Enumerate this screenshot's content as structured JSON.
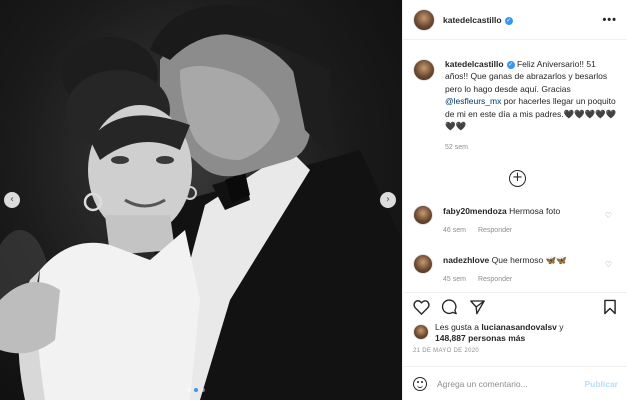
{
  "post": {
    "username": "katedelcastillo",
    "verified_icon": "verified-badge-icon",
    "more_icon": "more-options-icon",
    "carousel": {
      "active_index": 1,
      "count": 3
    }
  },
  "caption": {
    "username": "katedelcastillo",
    "text_before_mention": "Feliz Aniversario!! 51 años!! Que ganas de abrazarlos y besarlos pero lo hago desde aquí. Gracias ",
    "mention": "@lesfleurs_mx",
    "text_after_mention": " por hacerles llegar un poquito de mi en este día a mis padres.🖤🖤🖤🖤🖤🖤🖤",
    "time": "52 sem"
  },
  "comments": [
    {
      "username": "faby20mendoza",
      "text": "Hermosa foto",
      "time": "46 sem",
      "reply": "Responder"
    },
    {
      "username": "nadezhlove",
      "text": "Que hermoso 🦋🦋",
      "time": "45 sem",
      "reply": "Responder"
    }
  ],
  "likes": {
    "prefix": "Les gusta a ",
    "user": "lucianasandovalsv",
    "middle": " y",
    "count": "148,887 personas más"
  },
  "date": "21 DE MAYO DE 2020",
  "add_comment": {
    "placeholder": "Agrega un comentario...",
    "publish": "Publicar"
  },
  "icons": {
    "heart": "heart-icon",
    "comment": "comment-icon",
    "share": "share-icon",
    "save": "bookmark-icon",
    "load_more": "plus-circle-icon"
  },
  "colors": {
    "link": "#00376b",
    "accent": "#3897f0",
    "muted": "#8e8e8e",
    "publish_disabled": "#b2dffc"
  }
}
